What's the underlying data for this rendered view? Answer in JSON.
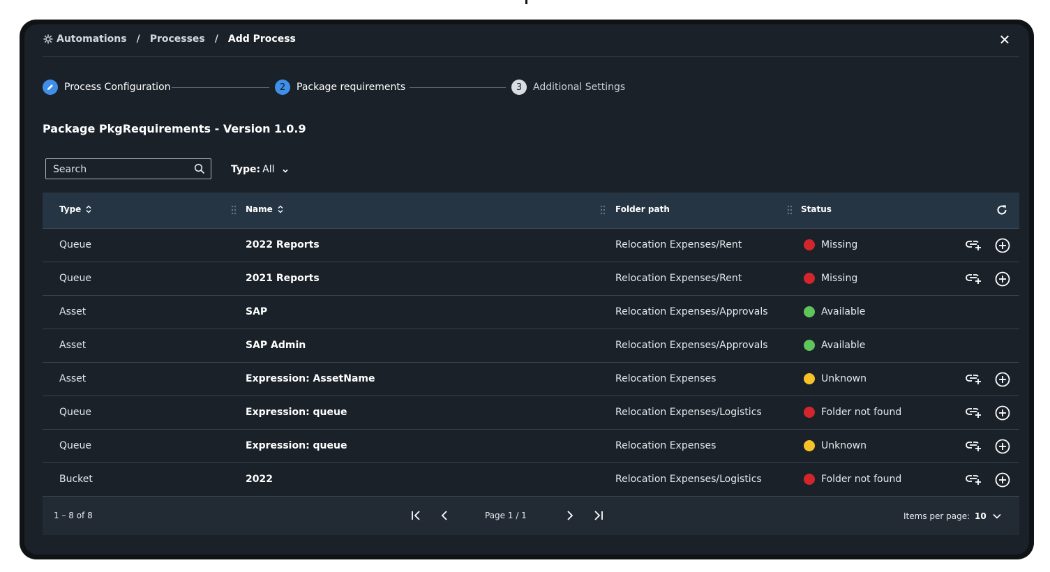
{
  "breadcrumb": {
    "items": [
      "Automations",
      "Processes",
      "Add Process"
    ],
    "separator": "/"
  },
  "close_symbol": "✕",
  "stepper": {
    "steps": [
      {
        "number": "",
        "icon": "pencil-icon",
        "label": "Process Configuration"
      },
      {
        "number": "2",
        "label": "Package requirements"
      },
      {
        "number": "3",
        "label": "Additional Settings"
      }
    ]
  },
  "page_title": "Package PkgRequirements - Version 1.0.9",
  "search": {
    "placeholder": "Search"
  },
  "type_filter": {
    "key": "Type:",
    "value": "All"
  },
  "table": {
    "columns": [
      "Type",
      "Name",
      "Folder path",
      "Status"
    ],
    "rows": [
      {
        "type": "Queue",
        "name": "2022 Reports",
        "folder": "Relocation Expenses/Rent",
        "status": "Missing",
        "status_color": "#d3262c",
        "actions": true
      },
      {
        "type": "Queue",
        "name": "2021 Reports",
        "folder": "Relocation Expenses/Rent",
        "status": "Missing",
        "status_color": "#d3262c",
        "actions": true
      },
      {
        "type": "Asset",
        "name": "SAP",
        "folder": "Relocation Expenses/Approvals",
        "status": "Available",
        "status_color": "#5fc45a",
        "actions": false
      },
      {
        "type": "Asset",
        "name": "SAP Admin",
        "folder": "Relocation Expenses/Approvals",
        "status": "Available",
        "status_color": "#5fc45a",
        "actions": false
      },
      {
        "type": "Asset",
        "name": "Expression: AssetName",
        "folder": "Relocation Expenses",
        "status": "Unknown",
        "status_color": "#f6c327",
        "actions": true
      },
      {
        "type": "Queue",
        "name": "Expression: queue",
        "folder": "Relocation Expenses/Logistics",
        "status": "Folder not found",
        "status_color": "#d3262c",
        "actions": true
      },
      {
        "type": "Queue",
        "name": "Expression: queue",
        "folder": "Relocation Expenses",
        "status": "Unknown",
        "status_color": "#f6c327",
        "actions": true
      },
      {
        "type": "Bucket",
        "name": "2022",
        "folder": "Relocation Expenses/Logistics",
        "status": "Folder not found",
        "status_color": "#d3262c",
        "actions": true
      }
    ]
  },
  "footer": {
    "range": "1 – 8 of 8",
    "page_info": "Page 1 / 1",
    "items_per_page_label": "Items per page:",
    "items_per_page_value": "10"
  },
  "colors": {
    "accent": "#3f8ee8",
    "panel": "#1a2128",
    "header_row": "#263543"
  }
}
